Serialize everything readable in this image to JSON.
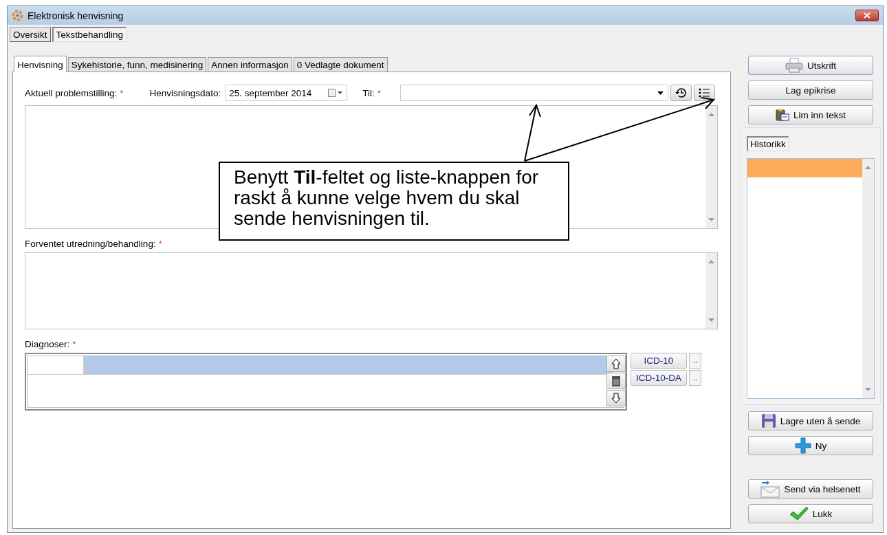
{
  "window": {
    "title": "Elektronisk henvisning"
  },
  "top_tabs": [
    {
      "label": "Oversikt",
      "selected": false
    },
    {
      "label": "Tekstbehandling",
      "selected": true
    }
  ],
  "tabs": [
    {
      "label": "Henvisning",
      "selected": true
    },
    {
      "label": "Sykehistorie, funn, medisinering",
      "selected": false
    },
    {
      "label": "Annen informasjon",
      "selected": false
    },
    {
      "label": "0 Vedlagte dokument",
      "selected": false
    }
  ],
  "form": {
    "problem_label": {
      "text": "Aktuell problemstilling:",
      "required_mark": "*"
    },
    "date_label": "Henvisningsdato:",
    "date_value": "25. september 2014",
    "to_label": {
      "text": "Til:",
      "required_mark": "*"
    },
    "expected_label": {
      "text": "Forventet utredning/behandling:",
      "required_mark": "*"
    }
  },
  "diagnoses": {
    "label": {
      "text": "Diagnoser:",
      "required_mark": "*"
    },
    "rows": [
      {
        "selected": true
      }
    ],
    "code_buttons": [
      {
        "label": "ICD-10",
        "more": ".."
      },
      {
        "label": "ICD-10-DA",
        "more": ".."
      }
    ]
  },
  "callout": {
    "text": "Benytt **Til**-feltet og liste-knappen for raskt å kunne velge hvem du skal sende henvisningen til."
  },
  "actions_top": [
    {
      "label": "Utskrift",
      "kind": "print"
    },
    {
      "label": "Lag epikrise",
      "kind": "plain"
    },
    {
      "label": "Lim inn tekst",
      "kind": "paste"
    }
  ],
  "history": {
    "tab": "Historikk",
    "items": [
      {
        "selected": true
      }
    ]
  },
  "actions_bottom": [
    {
      "label": "Lagre uten å sende",
      "kind": "save"
    },
    {
      "label": "Ny",
      "kind": "new"
    },
    {
      "label": "Send via helsenett",
      "kind": "send"
    },
    {
      "label": "Lukk",
      "kind": "close"
    }
  ]
}
